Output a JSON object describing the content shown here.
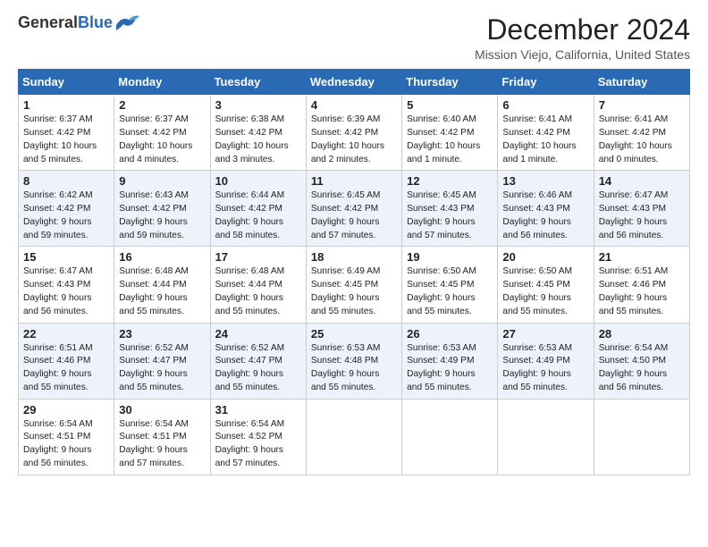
{
  "header": {
    "logo_general": "General",
    "logo_blue": "Blue",
    "month_title": "December 2024",
    "location": "Mission Viejo, California, United States"
  },
  "weekdays": [
    "Sunday",
    "Monday",
    "Tuesday",
    "Wednesday",
    "Thursday",
    "Friday",
    "Saturday"
  ],
  "weeks": [
    [
      {
        "day": "1",
        "lines": [
          "Sunrise: 6:37 AM",
          "Sunset: 4:42 PM",
          "Daylight: 10 hours",
          "and 5 minutes."
        ]
      },
      {
        "day": "2",
        "lines": [
          "Sunrise: 6:37 AM",
          "Sunset: 4:42 PM",
          "Daylight: 10 hours",
          "and 4 minutes."
        ]
      },
      {
        "day": "3",
        "lines": [
          "Sunrise: 6:38 AM",
          "Sunset: 4:42 PM",
          "Daylight: 10 hours",
          "and 3 minutes."
        ]
      },
      {
        "day": "4",
        "lines": [
          "Sunrise: 6:39 AM",
          "Sunset: 4:42 PM",
          "Daylight: 10 hours",
          "and 2 minutes."
        ]
      },
      {
        "day": "5",
        "lines": [
          "Sunrise: 6:40 AM",
          "Sunset: 4:42 PM",
          "Daylight: 10 hours",
          "and 1 minute."
        ]
      },
      {
        "day": "6",
        "lines": [
          "Sunrise: 6:41 AM",
          "Sunset: 4:42 PM",
          "Daylight: 10 hours",
          "and 1 minute."
        ]
      },
      {
        "day": "7",
        "lines": [
          "Sunrise: 6:41 AM",
          "Sunset: 4:42 PM",
          "Daylight: 10 hours",
          "and 0 minutes."
        ]
      }
    ],
    [
      {
        "day": "8",
        "lines": [
          "Sunrise: 6:42 AM",
          "Sunset: 4:42 PM",
          "Daylight: 9 hours",
          "and 59 minutes."
        ]
      },
      {
        "day": "9",
        "lines": [
          "Sunrise: 6:43 AM",
          "Sunset: 4:42 PM",
          "Daylight: 9 hours",
          "and 59 minutes."
        ]
      },
      {
        "day": "10",
        "lines": [
          "Sunrise: 6:44 AM",
          "Sunset: 4:42 PM",
          "Daylight: 9 hours",
          "and 58 minutes."
        ]
      },
      {
        "day": "11",
        "lines": [
          "Sunrise: 6:45 AM",
          "Sunset: 4:42 PM",
          "Daylight: 9 hours",
          "and 57 minutes."
        ]
      },
      {
        "day": "12",
        "lines": [
          "Sunrise: 6:45 AM",
          "Sunset: 4:43 PM",
          "Daylight: 9 hours",
          "and 57 minutes."
        ]
      },
      {
        "day": "13",
        "lines": [
          "Sunrise: 6:46 AM",
          "Sunset: 4:43 PM",
          "Daylight: 9 hours",
          "and 56 minutes."
        ]
      },
      {
        "day": "14",
        "lines": [
          "Sunrise: 6:47 AM",
          "Sunset: 4:43 PM",
          "Daylight: 9 hours",
          "and 56 minutes."
        ]
      }
    ],
    [
      {
        "day": "15",
        "lines": [
          "Sunrise: 6:47 AM",
          "Sunset: 4:43 PM",
          "Daylight: 9 hours",
          "and 56 minutes."
        ]
      },
      {
        "day": "16",
        "lines": [
          "Sunrise: 6:48 AM",
          "Sunset: 4:44 PM",
          "Daylight: 9 hours",
          "and 55 minutes."
        ]
      },
      {
        "day": "17",
        "lines": [
          "Sunrise: 6:48 AM",
          "Sunset: 4:44 PM",
          "Daylight: 9 hours",
          "and 55 minutes."
        ]
      },
      {
        "day": "18",
        "lines": [
          "Sunrise: 6:49 AM",
          "Sunset: 4:45 PM",
          "Daylight: 9 hours",
          "and 55 minutes."
        ]
      },
      {
        "day": "19",
        "lines": [
          "Sunrise: 6:50 AM",
          "Sunset: 4:45 PM",
          "Daylight: 9 hours",
          "and 55 minutes."
        ]
      },
      {
        "day": "20",
        "lines": [
          "Sunrise: 6:50 AM",
          "Sunset: 4:45 PM",
          "Daylight: 9 hours",
          "and 55 minutes."
        ]
      },
      {
        "day": "21",
        "lines": [
          "Sunrise: 6:51 AM",
          "Sunset: 4:46 PM",
          "Daylight: 9 hours",
          "and 55 minutes."
        ]
      }
    ],
    [
      {
        "day": "22",
        "lines": [
          "Sunrise: 6:51 AM",
          "Sunset: 4:46 PM",
          "Daylight: 9 hours",
          "and 55 minutes."
        ]
      },
      {
        "day": "23",
        "lines": [
          "Sunrise: 6:52 AM",
          "Sunset: 4:47 PM",
          "Daylight: 9 hours",
          "and 55 minutes."
        ]
      },
      {
        "day": "24",
        "lines": [
          "Sunrise: 6:52 AM",
          "Sunset: 4:47 PM",
          "Daylight: 9 hours",
          "and 55 minutes."
        ]
      },
      {
        "day": "25",
        "lines": [
          "Sunrise: 6:53 AM",
          "Sunset: 4:48 PM",
          "Daylight: 9 hours",
          "and 55 minutes."
        ]
      },
      {
        "day": "26",
        "lines": [
          "Sunrise: 6:53 AM",
          "Sunset: 4:49 PM",
          "Daylight: 9 hours",
          "and 55 minutes."
        ]
      },
      {
        "day": "27",
        "lines": [
          "Sunrise: 6:53 AM",
          "Sunset: 4:49 PM",
          "Daylight: 9 hours",
          "and 55 minutes."
        ]
      },
      {
        "day": "28",
        "lines": [
          "Sunrise: 6:54 AM",
          "Sunset: 4:50 PM",
          "Daylight: 9 hours",
          "and 56 minutes."
        ]
      }
    ],
    [
      {
        "day": "29",
        "lines": [
          "Sunrise: 6:54 AM",
          "Sunset: 4:51 PM",
          "Daylight: 9 hours",
          "and 56 minutes."
        ]
      },
      {
        "day": "30",
        "lines": [
          "Sunrise: 6:54 AM",
          "Sunset: 4:51 PM",
          "Daylight: 9 hours",
          "and 57 minutes."
        ]
      },
      {
        "day": "31",
        "lines": [
          "Sunrise: 6:54 AM",
          "Sunset: 4:52 PM",
          "Daylight: 9 hours",
          "and 57 minutes."
        ]
      },
      null,
      null,
      null,
      null
    ]
  ]
}
